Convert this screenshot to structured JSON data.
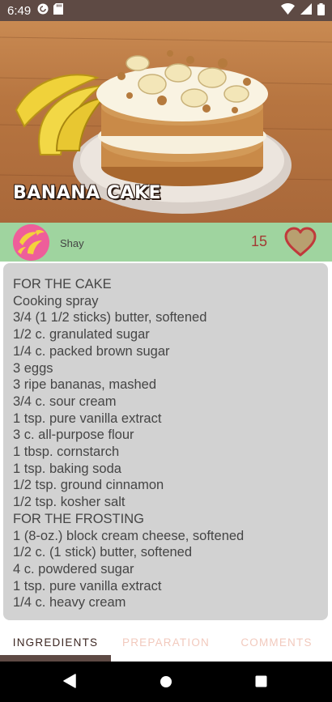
{
  "status_bar": {
    "time": "6:49",
    "icons_left": [
      "pocket-casts-icon",
      "sd-card-icon"
    ],
    "icons_right": [
      "wifi-icon",
      "cell-signal-icon",
      "battery-icon"
    ],
    "background": "#5e4a44"
  },
  "recipe": {
    "title": "BANANA CAKE",
    "author": "Shay",
    "likes": "15"
  },
  "ingredients": [
    "FOR THE CAKE",
    "Cooking spray",
    "3/4 (1 1/2 sticks) butter, softened",
    "1/2 c. granulated sugar",
    "1/4 c. packed brown sugar",
    "3 eggs",
    "3 ripe bananas, mashed",
    "3/4 c. sour cream",
    "1 tsp. pure vanilla extract",
    "3 c. all-purpose flour",
    "1 tbsp. cornstarch",
    "1 tsp. baking soda",
    "1/2 tsp. ground cinnamon",
    "1/2 tsp. kosher salt",
    "FOR THE FROSTING",
    "1 (8-oz.) block cream cheese, softened",
    "1/2 c. (1 stick) butter, softened",
    "4 c. powdered sugar",
    "1 tsp. pure vanilla extract",
    "1/4 c. heavy cream"
  ],
  "tabs": [
    {
      "label": "INGREDIENTS",
      "active": true
    },
    {
      "label": "PREPARATION",
      "active": false
    },
    {
      "label": "COMMENTS",
      "active": false
    }
  ],
  "colors": {
    "primary_dark": "#5e4a44",
    "author_bar": "#9fd49f",
    "card": "#d2d2d2",
    "heart_fill": "#b8a070",
    "heart_stroke": "#c0393b",
    "tab_inactive": "#f2c9bd"
  },
  "nav": {
    "back": "back-icon",
    "home": "home-icon",
    "recents": "recents-icon"
  }
}
